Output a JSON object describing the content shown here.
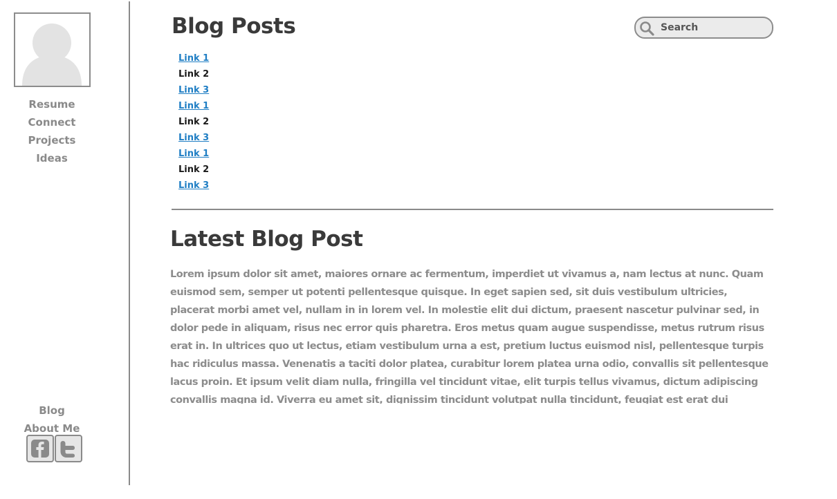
{
  "sidebar": {
    "nav_top": [
      {
        "label": "Resume"
      },
      {
        "label": "Connect"
      },
      {
        "label": "Projects"
      },
      {
        "label": "Ideas"
      }
    ],
    "nav_bottom": [
      {
        "label": "Blog"
      },
      {
        "label": "About Me"
      }
    ],
    "social": [
      {
        "icon": "facebook-icon"
      },
      {
        "icon": "twitter-icon"
      }
    ]
  },
  "header": {
    "title": "Blog Posts",
    "search": {
      "placeholder": "Search"
    }
  },
  "links": [
    {
      "label": "Link 1",
      "style": "link"
    },
    {
      "label": "Link 2",
      "style": "plain"
    },
    {
      "label": "Link 3",
      "style": "link"
    },
    {
      "label": "Link 1",
      "style": "link"
    },
    {
      "label": "Link 2",
      "style": "plain"
    },
    {
      "label": "Link 3",
      "style": "link"
    },
    {
      "label": "Link 1",
      "style": "link"
    },
    {
      "label": "Link 2",
      "style": "plain"
    },
    {
      "label": "Link 3",
      "style": "link"
    }
  ],
  "latest_post": {
    "title": "Latest Blog Post",
    "body": "Lorem ipsum dolor sit amet, maiores ornare ac fermentum, imperdiet ut vivamus a, nam lectus at nunc. Quam euismod sem, semper ut potenti pellentesque quisque. In eget sapien sed, sit duis vestibulum ultricies, placerat morbi amet vel, nullam in in lorem vel. In molestie elit dui dictum, praesent nascetur pulvinar sed, in dolor pede in aliquam, risus nec error quis pharetra. Eros metus quam augue suspendisse, metus rutrum risus erat in.  In ultrices quo ut lectus, etiam vestibulum urna a est, pretium luctus euismod nisl, pellentesque turpis hac ridiculus massa. Venenatis a taciti dolor platea, curabitur lorem platea urna odio, convallis sit pellentesque lacus proin. Et ipsum velit diam nulla, fringilla vel tincidunt vitae, elit turpis tellus vivamus, dictum adipiscing convallis magna id. Viverra eu amet sit, dignissim tincidunt volutpat nulla tincidunt, feugiat est erat dui tempor, fusce tortor auctor vestibulum. Venenatis praesent risus orci, ante"
  },
  "colors": {
    "link": "#1f7ec4",
    "heading": "#3a3a3a",
    "muted_text": "#8c8c8c",
    "divider": "#8a8a8a"
  }
}
